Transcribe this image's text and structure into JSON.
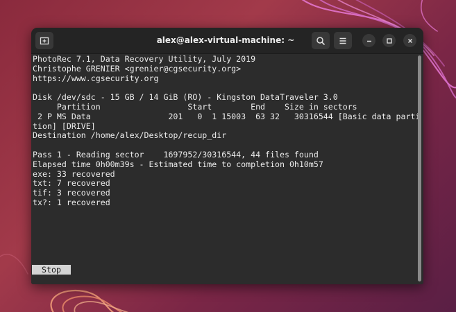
{
  "window": {
    "title": "alex@alex-virtual-machine: ~"
  },
  "terminal": {
    "lines": [
      "PhotoRec 7.1, Data Recovery Utility, July 2019",
      "Christophe GRENIER <grenier@cgsecurity.org>",
      "https://www.cgsecurity.org",
      "",
      "Disk /dev/sdc - 15 GB / 14 GiB (RO) - Kingston DataTraveler 3.0",
      "     Partition                  Start        End    Size in sectors",
      " 2 P MS Data                201   0  1 15003  63 32   30316544 [Basic data parti",
      "tion] [DRIVE]",
      "Destination /home/alex/Desktop/recup_dir",
      "",
      "Pass 1 - Reading sector    1697952/30316544, 44 files found",
      "Elapsed time 0h00m39s - Estimated time to completion 0h10m57",
      "exe: 33 recovered",
      "txt: 7 recovered",
      "tif: 3 recovered",
      "tx?: 1 recovered"
    ],
    "stop_label": "Stop"
  },
  "icons": {
    "new_tab": "new-tab-icon",
    "search": "search-icon",
    "menu": "hamburger-menu-icon",
    "minimize": "minimize-icon",
    "maximize": "maximize-icon",
    "close": "close-icon"
  },
  "colors": {
    "terminal_bg": "#2c2c2c",
    "terminal_fg": "#ececec",
    "titlebar_bg": "#242424",
    "button_bg": "#383838",
    "stop_button_bg": "#d4d4d4"
  }
}
